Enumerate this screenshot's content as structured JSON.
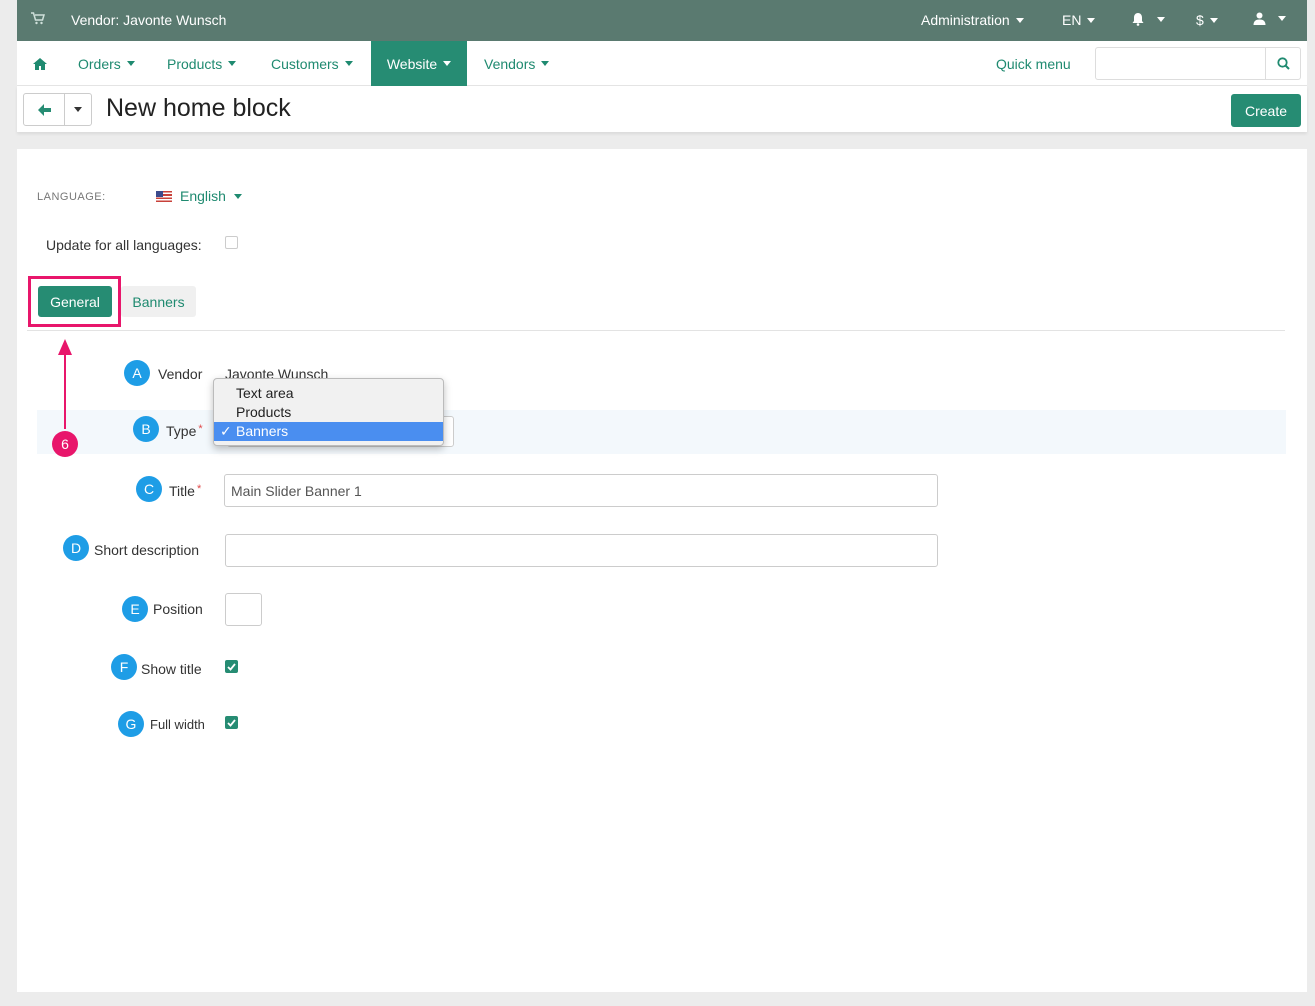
{
  "topbar": {
    "vendor_title": "Vendor: Javonte Wunsch",
    "administration": "Administration",
    "language": "EN",
    "currency": "$"
  },
  "nav": {
    "items": [
      "Orders",
      "Products",
      "Customers",
      "Website",
      "Vendors"
    ],
    "active": "Website",
    "quick_menu": "Quick menu",
    "search_placeholder": ""
  },
  "actionbar": {
    "title": "New home block",
    "create_label": "Create"
  },
  "form": {
    "language_label": "LANGUAGE:",
    "language_value": "English",
    "update_all_label": "Update for all languages:",
    "tabs": [
      "General",
      "Banners"
    ],
    "vendor_label": "Vendor",
    "vendor_value": "Javonte Wunsch",
    "type_label": "Type",
    "type_options": [
      "Text area",
      "Products",
      "Banners"
    ],
    "type_selected": "Banners",
    "title_label": "Title",
    "title_value": "Main Slider Banner 1",
    "short_desc_label": "Short description",
    "short_desc_value": "",
    "position_label": "Position",
    "position_value": "",
    "show_title_label": "Show title",
    "full_width_label": "Full width"
  },
  "annotations": {
    "badges": [
      "A",
      "B",
      "C",
      "D",
      "E",
      "F",
      "G"
    ],
    "step": "6"
  },
  "colors": {
    "topbar": "#5a7a70",
    "accent": "#268c73",
    "link": "#1f8a70",
    "badge": "#1e9de6",
    "highlight": "#e8166b"
  }
}
